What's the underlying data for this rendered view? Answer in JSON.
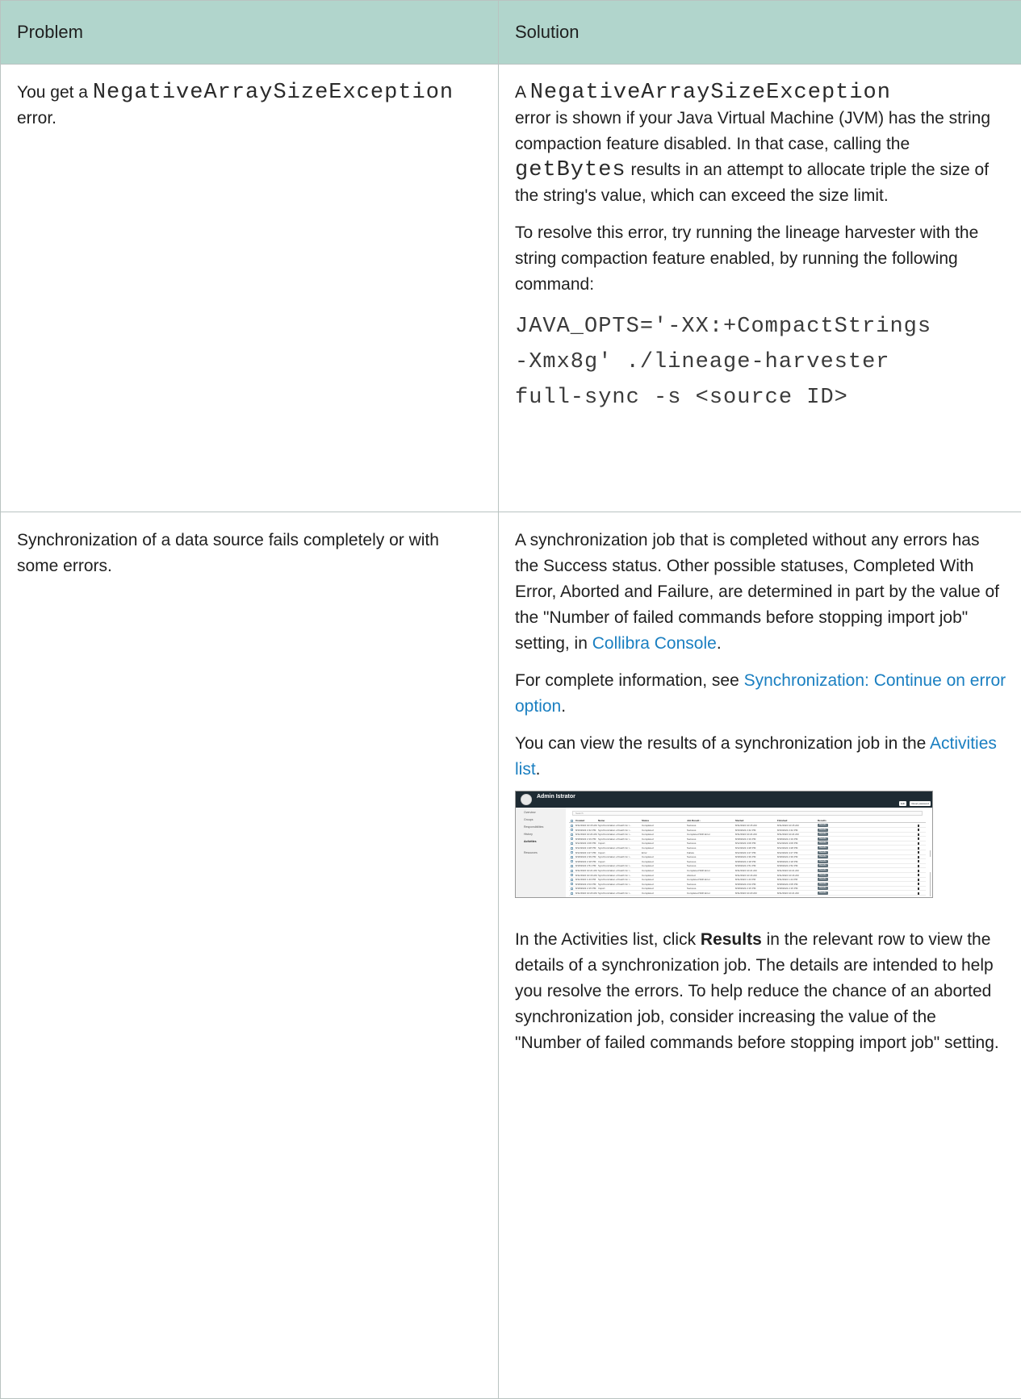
{
  "table": {
    "headers": {
      "problem": "Problem",
      "solution": "Solution"
    },
    "row1": {
      "problem": {
        "pre": "You get a ",
        "code": "NegativeArraySizeException",
        "post": " error."
      },
      "solution": {
        "p1": {
          "pre": "A ",
          "code1": "NegativeArraySizeException",
          "mid": " error is shown if your Java Virtual Machine (JVM) has the string compaction feature disabled. In that case, calling the ",
          "code2": "getBytes",
          "post": " results in an attempt to allocate triple the size of the string's value, which can exceed the size limit."
        },
        "p2": "To resolve this error, try running the lineage harvester with the string compaction feature enabled, by running the following command:",
        "command": [
          "JAVA_OPTS='-XX:+CompactStrings",
          "-Xmx8g' ./lineage-harvester",
          "full-sync -s <source ID>"
        ]
      }
    },
    "row2": {
      "problem": "Synchronization of a data source fails completely or with some errors.",
      "solution": {
        "p1": {
          "pre": "A synchronization job that is completed without any errors has the Success status. Other possible statuses, Completed With Error, Aborted and Failure, are determined in part by the value of the \"Number of failed commands before stopping import job\" setting, in ",
          "link": "Collibra Console",
          "post": "."
        },
        "p2": {
          "pre": "For complete information, see ",
          "link": "Synchronization: Continue on error option",
          "post": "."
        },
        "p3": {
          "pre": "You can view the results of a synchronization job in the ",
          "link": "Activities list",
          "post": "."
        },
        "p4": {
          "pre": "In the Activities list, click ",
          "bold": "Results",
          "post": " in the relevant row to view the details of a synchronization job. The details are intended to help you resolve the errors. To help reduce the chance of an aborted synchronization job, consider increasing the value of the \"Number of failed commands before stopping import job\" setting."
        }
      }
    }
  },
  "screenshot": {
    "user_name": "Admin Istrator",
    "buttons": [
      "Edit",
      "Reset password"
    ],
    "sidebar": [
      "Overview",
      "Groups",
      "Responsibilities",
      "History",
      "Activities",
      "Resources"
    ],
    "active_sidebar": "Activities",
    "search_placeholder": "Search",
    "columns": [
      "Created",
      "Name",
      "Status",
      "Job Result ↓",
      "Started",
      "Finished",
      "Results"
    ],
    "rows": [
      [
        "8/11/2022 10:15 AM",
        "Synchronization of batch for i...",
        "Completed",
        "Success",
        "8/11/2022 10:15 AM",
        "8/11/2022 10:15 AM"
      ],
      [
        "8/16/2022 2:42 PM",
        "Synchronization of batch for i...",
        "Completed",
        "Success",
        "8/16/2022 2:42 PM",
        "8/16/2022 2:42 PM"
      ],
      [
        "8/11/2022 10:24 AM",
        "Synchronization of batch for i...",
        "Completed",
        "Completed With Error",
        "8/11/2022 10:24 AM",
        "8/11/2022 10:24 AM"
      ],
      [
        "8/18/2022 2:19 PM",
        "Synchronization of batch for i...",
        "Completed",
        "Success",
        "8/18/2022 2:19 PM",
        "8/18/2022 2:19 PM"
      ],
      [
        "8/12/2022 4:06 PM",
        "Import",
        "Completed",
        "Success",
        "8/12/2022 4:06 PM",
        "8/12/2022 4:06 PM"
      ],
      [
        "8/12/2022 4:28 PM",
        "Synchronization of batch for i...",
        "Completed",
        "Success",
        "8/12/2022 4:28 PM",
        "8/12/2022 4:28 PM"
      ],
      [
        "8/12/2022 4:27 PM",
        "Import",
        "Error",
        "Failure",
        "8/12/2022 4:27 PM",
        "8/12/2022 4:27 PM"
      ],
      [
        "8/18/2022 2:39 PM",
        "Synchronization of batch for i...",
        "Completed",
        "Success",
        "8/18/2022 2:39 PM",
        "8/18/2022 2:39 PM"
      ],
      [
        "8/18/2022 2:18 PM",
        "Import",
        "Completed",
        "Success",
        "8/18/2022 2:18 PM",
        "8/18/2022 2:18 PM"
      ],
      [
        "8/18/2022 2:51 PM",
        "Synchronization of batch for i...",
        "Completed",
        "Success",
        "8/18/2022 2:51 PM",
        "8/18/2022 2:52 PM"
      ],
      [
        "8/11/2022 10:21 AM",
        "Synchronization of batch for i...",
        "Completed",
        "Completed With Error",
        "8/11/2022 10:21 AM",
        "8/11/2022 10:21 AM"
      ],
      [
        "8/11/2022 10:16 AM",
        "Synchronization of batch for i...",
        "Completed",
        "Aborted",
        "8/11/2022 10:16 AM",
        "8/11/2022 10:16 AM"
      ],
      [
        "8/11/2022 1:23 PM",
        "Synchronization of batch for i...",
        "Completed",
        "Completed With Error",
        "8/11/2022 1:23 PM",
        "8/11/2022 1:24 PM"
      ],
      [
        "8/18/2022 2:04 PM",
        "Synchronization of batch for i...",
        "Completed",
        "Success",
        "8/18/2022 2:04 PM",
        "8/18/2022 2:05 PM"
      ],
      [
        "8/18/2022 2:15 PM",
        "Import",
        "Completed",
        "Success",
        "8/18/2022 2:15 PM",
        "8/18/2022 2:15 PM"
      ],
      [
        "8/11/2022 10:20 AM",
        "Synchronization of batch for i...",
        "Completed",
        "Completed With Error",
        "8/11/2022 10:20 AM",
        "8/11/2022 10:21 AM"
      ]
    ],
    "results_label": "Results"
  }
}
